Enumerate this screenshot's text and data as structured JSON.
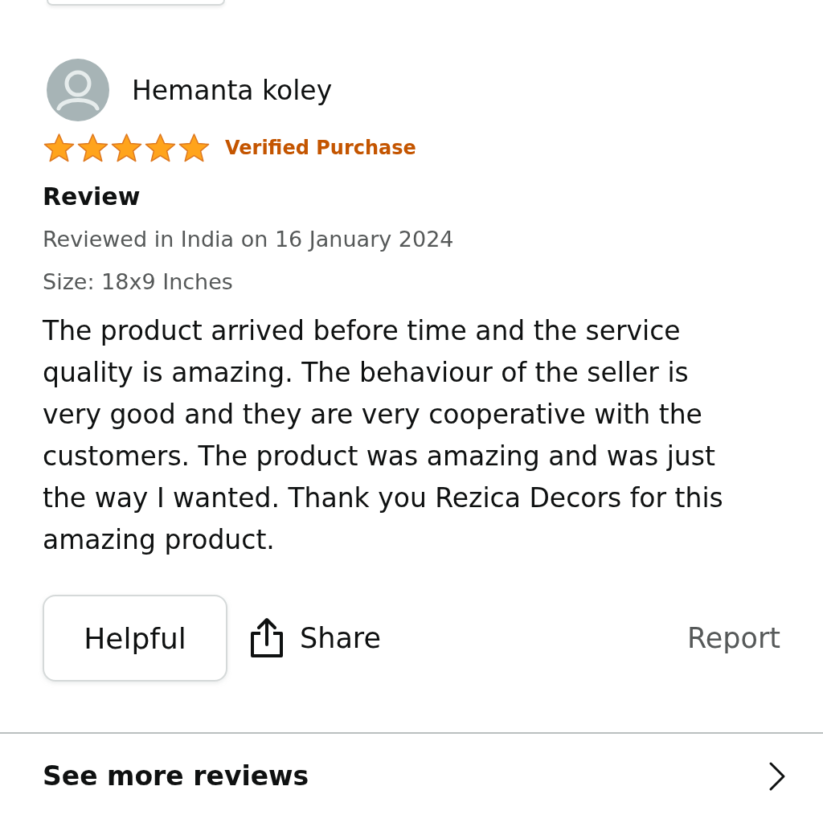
{
  "review": {
    "author": "Hemanta koley",
    "stars": 5,
    "badge": "Verified Purchase",
    "title": "Review",
    "date": "Reviewed in India on 16 January 2024",
    "variant": "Size: 18x9 Inches",
    "body": "The product arrived before time and the service quality is amazing. The behaviour of the seller is very good and they are very cooperative with the customers. The product was amazing and was just the way I wanted. Thank you Rezica Decors for this amazing product.",
    "actions": {
      "helpful": "Helpful",
      "share": "Share",
      "report": "Report"
    }
  },
  "footer": {
    "link": "See more reviews"
  }
}
